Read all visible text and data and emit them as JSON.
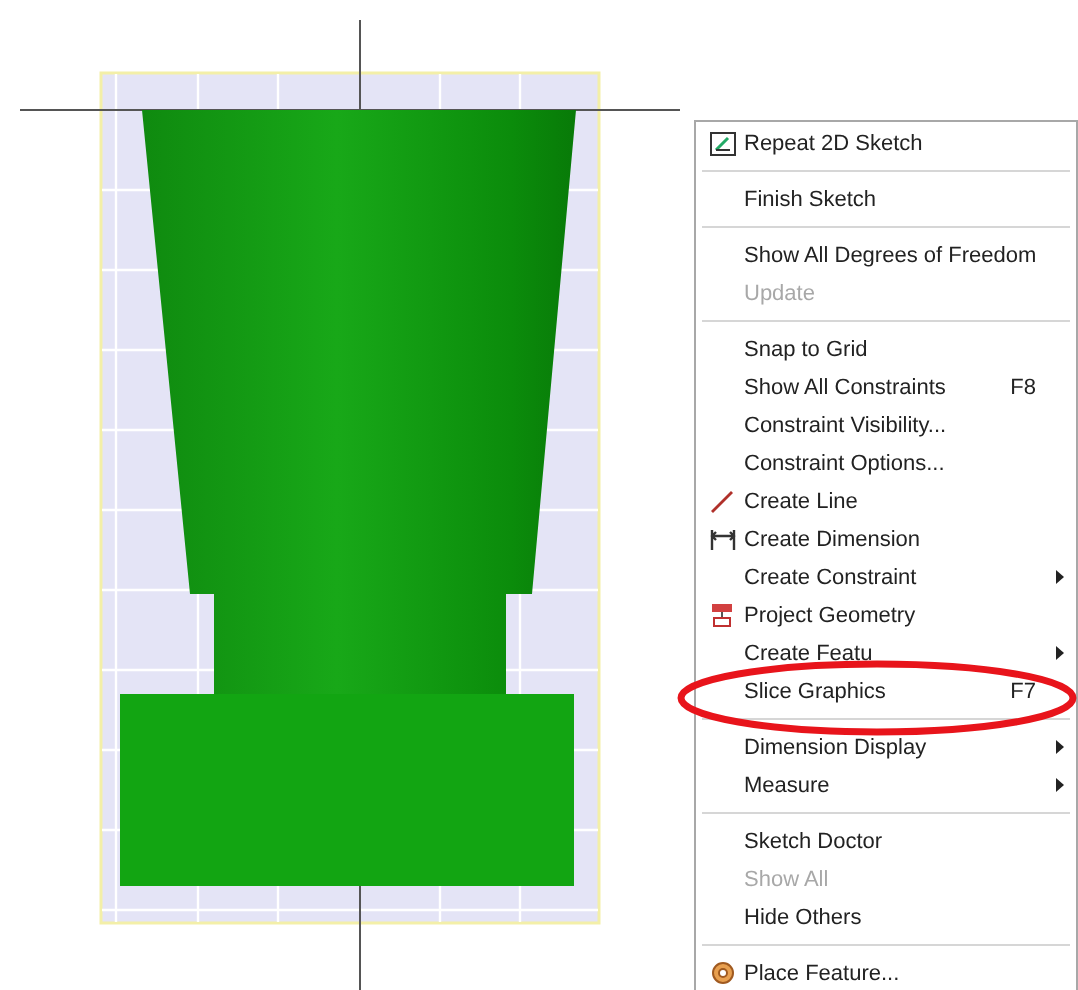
{
  "menu": {
    "items": [
      {
        "kind": "command",
        "label": "Repeat 2D Sketch",
        "disabled": false,
        "submenu": false
      },
      {
        "kind": "separator"
      },
      {
        "kind": "command",
        "label": "Finish Sketch",
        "disabled": false,
        "submenu": false
      },
      {
        "kind": "separator"
      },
      {
        "kind": "command",
        "label": "Show All Degrees of Freedom",
        "disabled": false,
        "submenu": false
      },
      {
        "kind": "command",
        "label": "Update",
        "disabled": true,
        "submenu": false
      },
      {
        "kind": "separator"
      },
      {
        "kind": "command",
        "label": "Snap to Grid",
        "disabled": false,
        "submenu": false
      },
      {
        "kind": "command",
        "label": "Show All Constraints",
        "shortcut": "F8",
        "disabled": false,
        "submenu": false
      },
      {
        "kind": "command",
        "label": "Constraint Visibility...",
        "disabled": false,
        "submenu": false
      },
      {
        "kind": "command",
        "label": "Constraint Options...",
        "disabled": false,
        "submenu": false
      },
      {
        "kind": "command",
        "label": "Create Line",
        "disabled": false,
        "submenu": false
      },
      {
        "kind": "command",
        "label": "Create Dimension",
        "disabled": false,
        "submenu": false
      },
      {
        "kind": "command",
        "label": "Create Constraint",
        "disabled": false,
        "submenu": true
      },
      {
        "kind": "command",
        "label": "Project Geometry",
        "disabled": false,
        "submenu": false
      },
      {
        "kind": "command",
        "label": "Create Featu",
        "disabled": false,
        "submenu": true
      },
      {
        "kind": "command",
        "label": "Slice Graphics",
        "shortcut": "F7",
        "disabled": false,
        "submenu": false
      },
      {
        "kind": "separator"
      },
      {
        "kind": "command",
        "label": "Dimension Display",
        "disabled": false,
        "submenu": true
      },
      {
        "kind": "command",
        "label": "Measure",
        "disabled": false,
        "submenu": true
      },
      {
        "kind": "separator"
      },
      {
        "kind": "command",
        "label": "Sketch Doctor",
        "disabled": false,
        "submenu": false
      },
      {
        "kind": "command",
        "label": "Show All",
        "disabled": true,
        "submenu": false
      },
      {
        "kind": "command",
        "label": "Hide Others",
        "disabled": false,
        "submenu": false
      },
      {
        "kind": "separator"
      },
      {
        "kind": "command",
        "label": "Place Feature...",
        "disabled": false,
        "submenu": false
      }
    ]
  }
}
